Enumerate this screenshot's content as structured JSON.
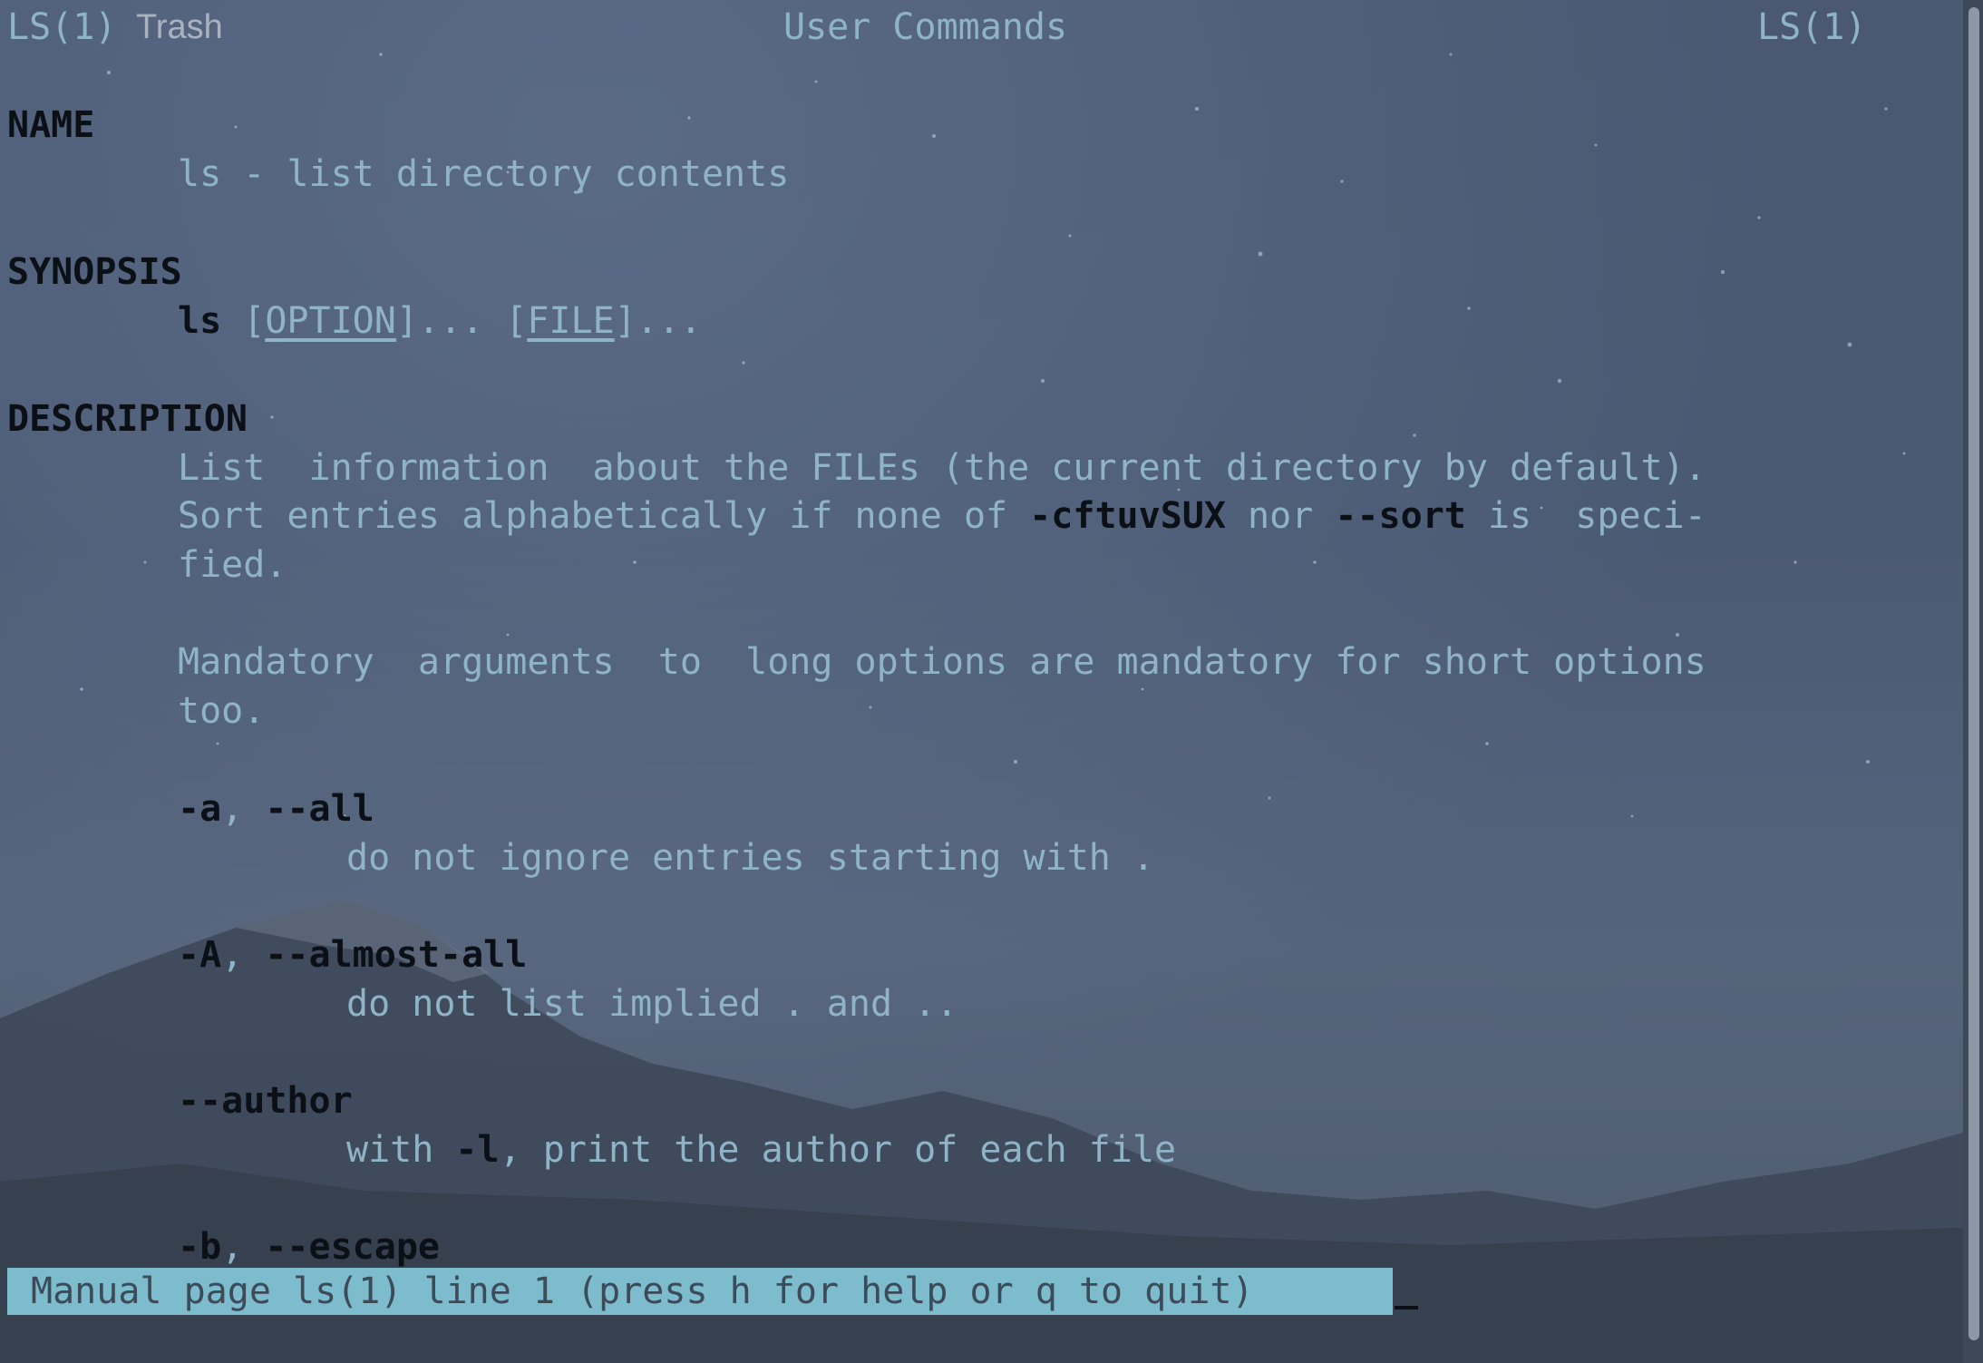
{
  "header": {
    "left": "LS(1)",
    "overlay": "Trash",
    "center": "User Commands",
    "right": "LS(1)"
  },
  "sections": {
    "name": {
      "heading": "NAME",
      "text": "ls - list directory contents"
    },
    "synopsis": {
      "heading": "SYNOPSIS",
      "cmd": "ls",
      "option": "OPTION",
      "file": "FILE"
    },
    "description": {
      "heading": "DESCRIPTION",
      "line1": "List  information  about the FILEs (the current directory by default).",
      "line2a": "Sort entries alphabetically if none of ",
      "line2b": "-cftuvSUX",
      "line2c": " nor ",
      "line2d": "--sort",
      "line2e": " is  speci‐",
      "line3": "fied.",
      "line4": "Mandatory  arguments  to  long options are mandatory for short options",
      "line5": "too."
    },
    "options": [
      {
        "short": "-a",
        "long": "--all",
        "desc": "do not ignore entries starting with ."
      },
      {
        "short": "-A",
        "long": "--almost-all",
        "desc": "do not list implied . and .."
      },
      {
        "long": "--author",
        "desc_a": "with ",
        "desc_flag": "-l",
        "desc_b": ", print the author of each file"
      },
      {
        "short": "-b",
        "long": "--escape"
      }
    ]
  },
  "status": {
    "text": "Manual page ls(1) line 1 (press h for help or q to quit)"
  }
}
